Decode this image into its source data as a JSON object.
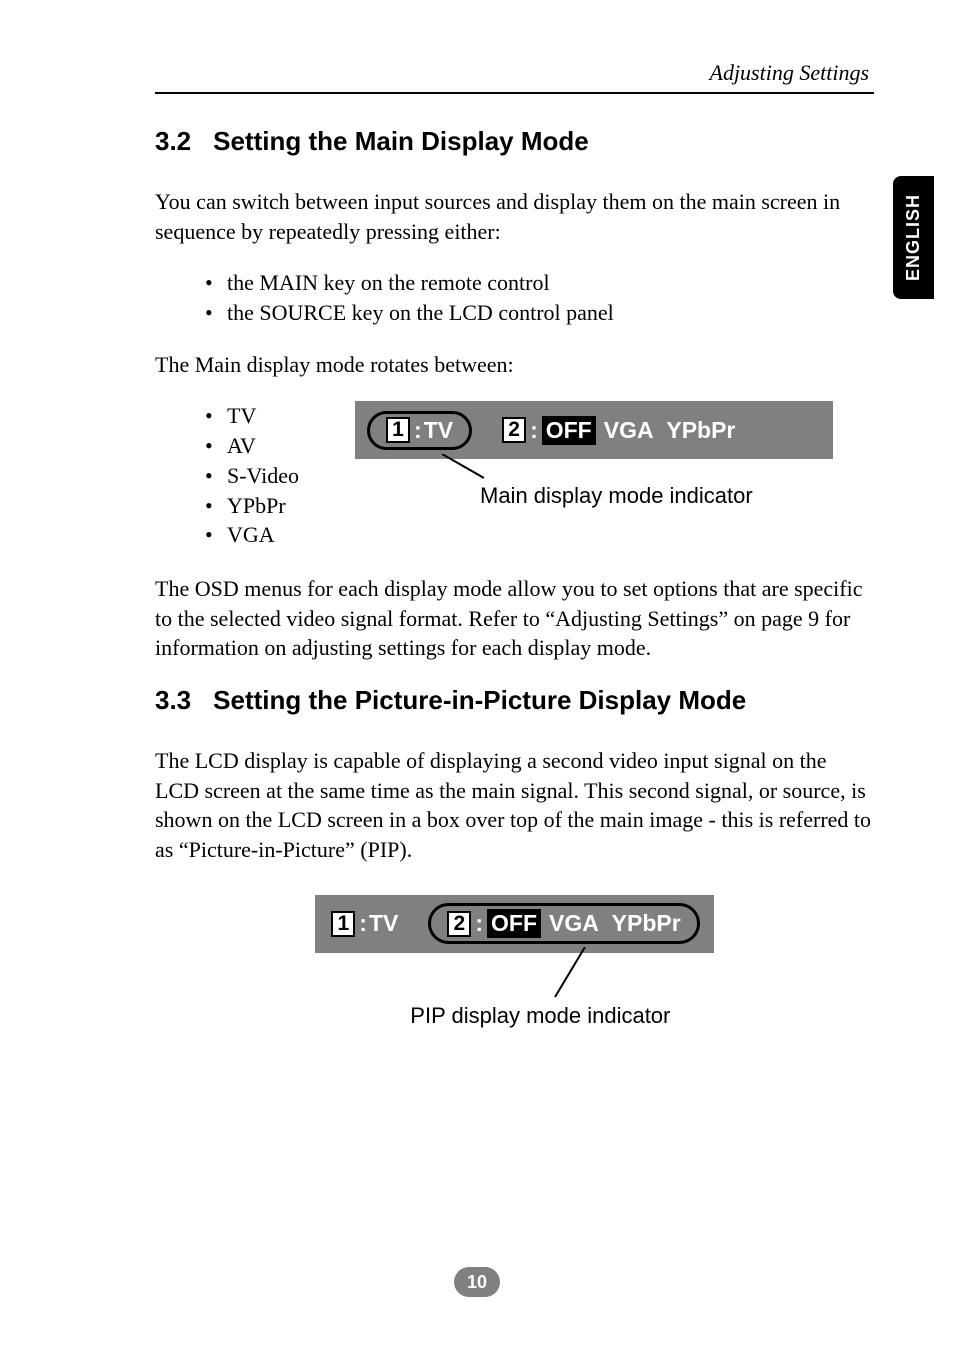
{
  "header": {
    "running_title": "Adjusting Settings"
  },
  "side_tab": "ENGLISH",
  "section_32": {
    "number": "3.2",
    "title": "Setting the Main Display Mode",
    "para1": "You can switch between input sources and display them on the main screen in sequence by repeatedly pressing either:",
    "keys": [
      "the MAIN key on the remote control",
      "the SOURCE key on the LCD control panel"
    ],
    "para2": "The Main display mode rotates between:",
    "modes": [
      "TV",
      "AV",
      "S-Video",
      "YPbPr",
      "VGA"
    ],
    "indicator": {
      "slot1_num": "1",
      "slot1_val": "TV",
      "slot2_num": "2",
      "slot2_val": "OFF",
      "extra1": "VGA",
      "extra2": "YPbPr",
      "caption": "Main display mode indicator"
    },
    "para3": "The OSD menus for each display mode allow you to set options that are specific to the selected video signal format. Refer to “Adjusting Settings” on page 9 for information on adjusting settings for each display mode."
  },
  "section_33": {
    "number": "3.3",
    "title": "Setting the Picture-in-Picture Display Mode",
    "para1": "The LCD display is capable of displaying a second video input signal on the LCD screen at the same time as the main signal. This second signal, or source, is shown on the LCD screen in a box over top of the main image - this is referred to as “Picture-in-Picture” (PIP).",
    "indicator": {
      "slot1_num": "1",
      "slot1_val": "TV",
      "slot2_num": "2",
      "slot2_val": "OFF",
      "extra1": "VGA",
      "extra2": "YPbPr",
      "caption": "PIP display mode indicator"
    }
  },
  "page_number": "10"
}
